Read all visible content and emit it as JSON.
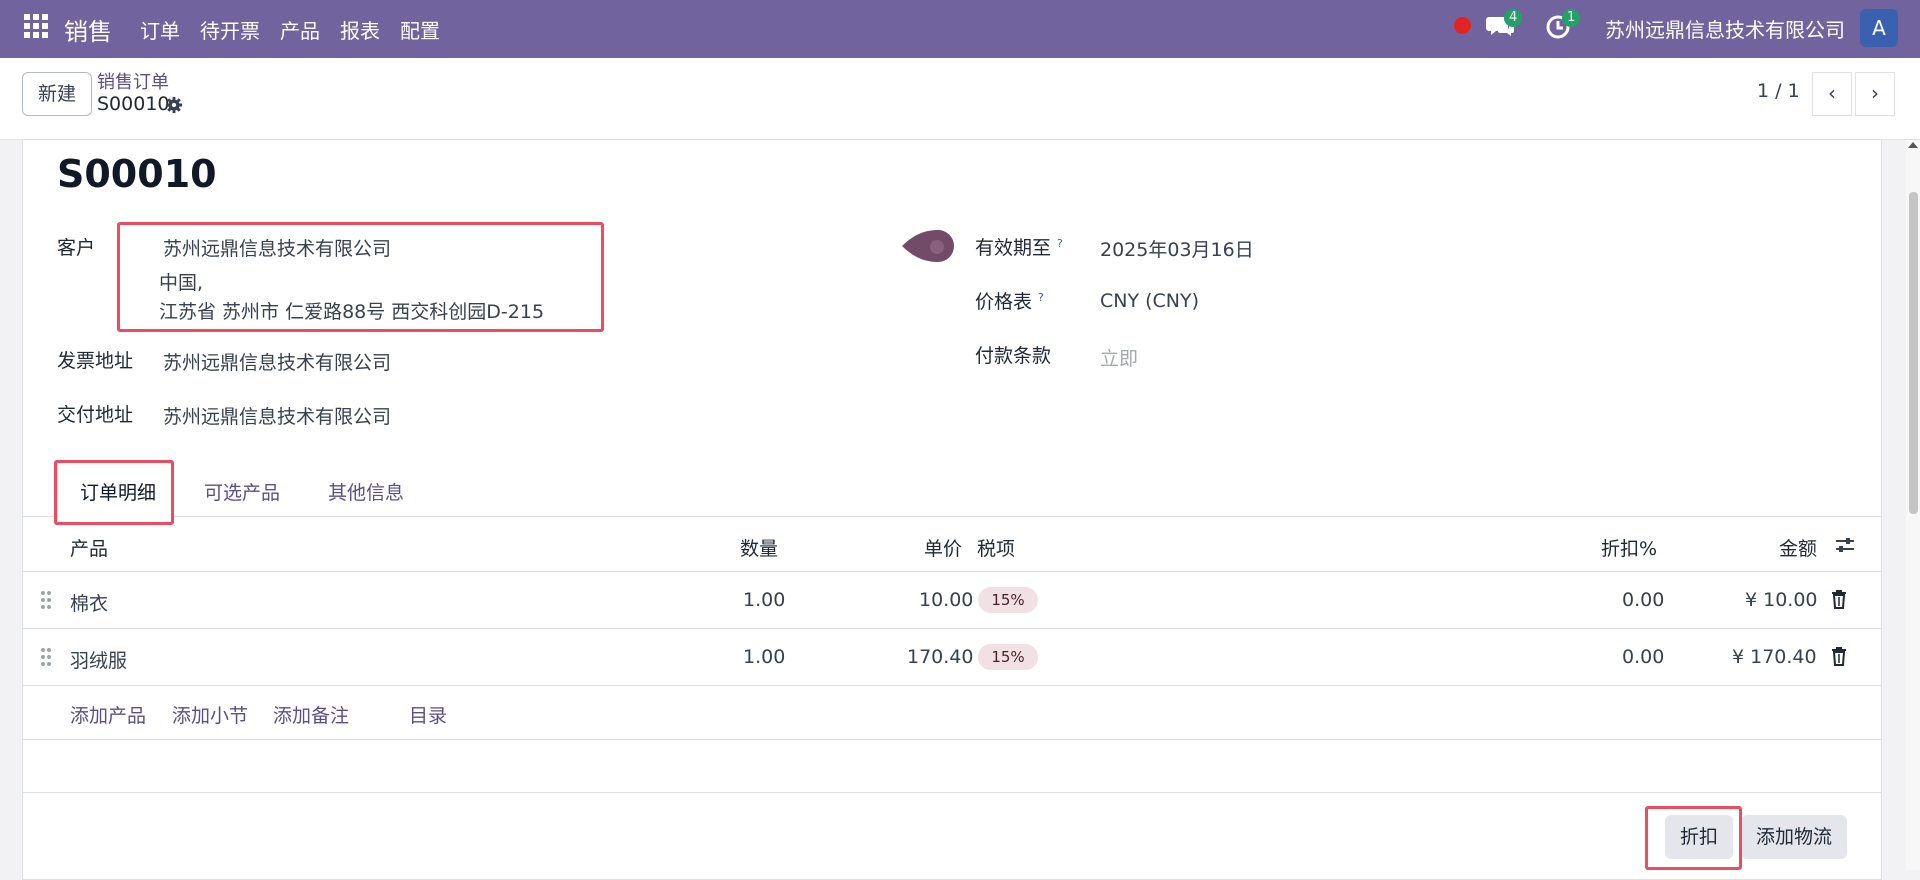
{
  "topbar": {
    "app_name": "销售",
    "menu": [
      "订单",
      "待开票",
      "产品",
      "报表",
      "配置"
    ],
    "messages_count": "4",
    "activities_count": "1",
    "company": "苏州远鼎信息技术有限公司",
    "avatar_letter": "A"
  },
  "control_panel": {
    "new_label": "新建",
    "breadcrumb_parent": "销售订单",
    "record_name": "S00010",
    "pager": "1 / 1",
    "prev": "‹",
    "next": "›"
  },
  "form": {
    "title": "S00010",
    "customer_label": "客户",
    "customer_name": "苏州远鼎信息技术有限公司",
    "customer_address_1": "中国,",
    "customer_address_2": "江苏省 苏州市 仁爱路88号 西交科创园D-215",
    "invoice_address_label": "发票地址",
    "invoice_address": "苏州远鼎信息技术有限公司",
    "delivery_address_label": "交付地址",
    "delivery_address": "苏州远鼎信息技术有限公司",
    "validity_label": "有效期至",
    "validity": "2025年03月16日",
    "pricelist_label": "价格表",
    "pricelist": "CNY (CNY)",
    "payment_terms_label": "付款条款",
    "payment_terms_placeholder": "立即",
    "help_mark": "?"
  },
  "tabs": [
    "订单明细",
    "可选产品",
    "其他信息"
  ],
  "order_lines": {
    "headers": {
      "product": "产品",
      "quantity": "数量",
      "unit_price": "单价",
      "taxes": "税项",
      "discount": "折扣%",
      "amount": "金额"
    },
    "rows": [
      {
        "product": "棉衣",
        "quantity": "1.00",
        "unit_price": "10.00",
        "tax": "15%",
        "discount": "0.00",
        "amount": "¥ 10.00"
      },
      {
        "product": "羽绒服",
        "quantity": "1.00",
        "unit_price": "170.40",
        "tax": "15%",
        "discount": "0.00",
        "amount": "¥ 170.40"
      }
    ],
    "add_links": [
      "添加产品",
      "添加小节",
      "添加备注",
      "目录"
    ]
  },
  "actions": {
    "discount": "折扣",
    "add_shipping": "添加物流"
  },
  "colors": {
    "topbar": "#71639e",
    "accent": "#5d4e8a",
    "highlight_box": "#ec4c62",
    "tax_badge": "#f1e1e4"
  }
}
